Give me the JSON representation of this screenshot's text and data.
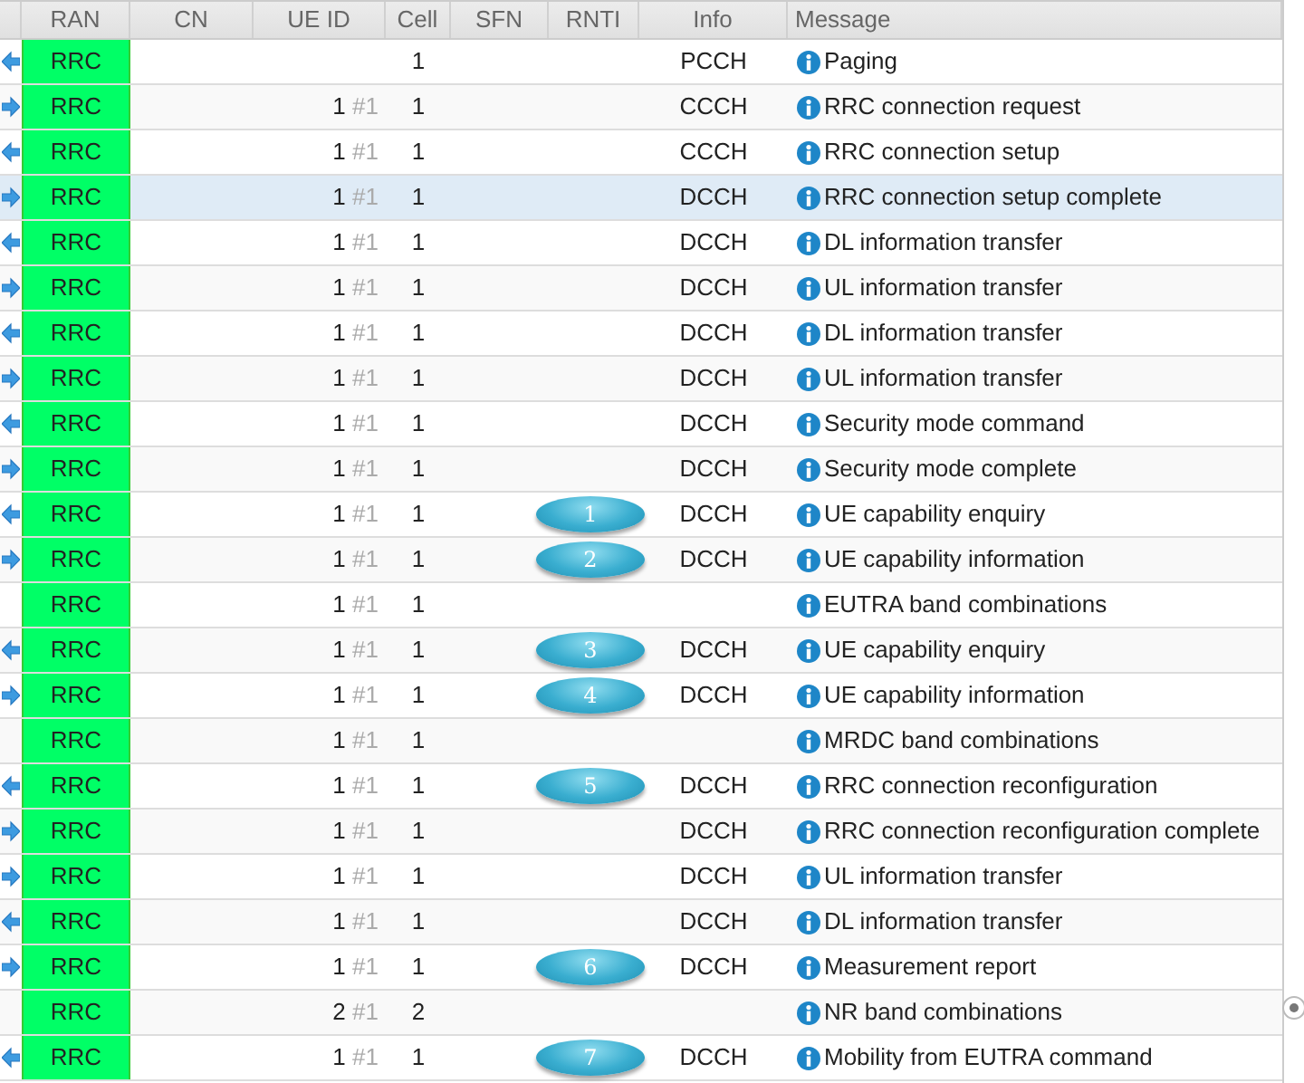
{
  "columns": [
    "RAN",
    "CN",
    "UE ID",
    "Cell",
    "SFN",
    "RNTI",
    "Info",
    "Message"
  ],
  "rows": [
    {
      "kind": "downlink",
      "ran": "RRC",
      "cell": "1",
      "info": "PCCH",
      "message": "Paging",
      "selected": false
    },
    {
      "kind": "uplink",
      "ran": "RRC",
      "ue_id": "1",
      "ue_index": "#1",
      "cell": "1",
      "info": "CCCH",
      "message": "RRC connection request",
      "selected": false
    },
    {
      "kind": "downlink",
      "ran": "RRC",
      "ue_id": "1",
      "ue_index": "#1",
      "cell": "1",
      "info": "CCCH",
      "message": "RRC connection setup",
      "selected": false
    },
    {
      "kind": "uplink",
      "ran": "RRC",
      "ue_id": "1",
      "ue_index": "#1",
      "cell": "1",
      "info": "DCCH",
      "message": "RRC connection setup complete",
      "selected": true
    },
    {
      "kind": "downlink",
      "ran": "RRC",
      "ue_id": "1",
      "ue_index": "#1",
      "cell": "1",
      "info": "DCCH",
      "message": "DL information transfer",
      "selected": false
    },
    {
      "kind": "uplink",
      "ran": "RRC",
      "ue_id": "1",
      "ue_index": "#1",
      "cell": "1",
      "info": "DCCH",
      "message": "UL information transfer",
      "selected": false
    },
    {
      "kind": "downlink",
      "ran": "RRC",
      "ue_id": "1",
      "ue_index": "#1",
      "cell": "1",
      "info": "DCCH",
      "message": "DL information transfer",
      "selected": false
    },
    {
      "kind": "uplink",
      "ran": "RRC",
      "ue_id": "1",
      "ue_index": "#1",
      "cell": "1",
      "info": "DCCH",
      "message": "UL information transfer",
      "selected": false
    },
    {
      "kind": "downlink",
      "ran": "RRC",
      "ue_id": "1",
      "ue_index": "#1",
      "cell": "1",
      "info": "DCCH",
      "message": "Security mode command",
      "selected": false
    },
    {
      "kind": "uplink",
      "ran": "RRC",
      "ue_id": "1",
      "ue_index": "#1",
      "cell": "1",
      "info": "DCCH",
      "message": "Security mode complete",
      "selected": false
    },
    {
      "kind": "downlink",
      "ran": "RRC",
      "ue_id": "1",
      "ue_index": "#1",
      "cell": "1",
      "marker": "1",
      "info": "DCCH",
      "message": "UE capability enquiry",
      "selected": false
    },
    {
      "kind": "uplink",
      "ran": "RRC",
      "ue_id": "1",
      "ue_index": "#1",
      "cell": "1",
      "marker": "2",
      "info": "DCCH",
      "message": "UE capability information",
      "selected": false
    },
    {
      "kind": "note",
      "ran": "RRC",
      "ue_id": "1",
      "ue_index": "#1",
      "cell": "1",
      "message": "EUTRA band combinations",
      "selected": false
    },
    {
      "kind": "downlink",
      "ran": "RRC",
      "ue_id": "1",
      "ue_index": "#1",
      "cell": "1",
      "marker": "3",
      "info": "DCCH",
      "message": "UE capability enquiry",
      "selected": false
    },
    {
      "kind": "uplink",
      "ran": "RRC",
      "ue_id": "1",
      "ue_index": "#1",
      "cell": "1",
      "marker": "4",
      "info": "DCCH",
      "message": "UE capability information",
      "selected": false
    },
    {
      "kind": "note",
      "ran": "RRC",
      "ue_id": "1",
      "ue_index": "#1",
      "cell": "1",
      "message": "MRDC band combinations",
      "selected": false
    },
    {
      "kind": "downlink",
      "ran": "RRC",
      "ue_id": "1",
      "ue_index": "#1",
      "cell": "1",
      "marker": "5",
      "info": "DCCH",
      "message": "RRC connection reconfiguration",
      "selected": false
    },
    {
      "kind": "uplink",
      "ran": "RRC",
      "ue_id": "1",
      "ue_index": "#1",
      "cell": "1",
      "info": "DCCH",
      "message": "RRC connection reconfiguration complete",
      "selected": false
    },
    {
      "kind": "uplink",
      "ran": "RRC",
      "ue_id": "1",
      "ue_index": "#1",
      "cell": "1",
      "info": "DCCH",
      "message": "UL information transfer",
      "selected": false
    },
    {
      "kind": "downlink",
      "ran": "RRC",
      "ue_id": "1",
      "ue_index": "#1",
      "cell": "1",
      "info": "DCCH",
      "message": "DL information transfer",
      "selected": false
    },
    {
      "kind": "uplink",
      "ran": "RRC",
      "ue_id": "1",
      "ue_index": "#1",
      "cell": "1",
      "marker": "6",
      "info": "DCCH",
      "message": "Measurement report",
      "selected": false
    },
    {
      "kind": "note",
      "ran": "RRC",
      "ue_id": "2",
      "ue_index": "#1",
      "cell": "2",
      "message": "NR band combinations",
      "selected": false
    },
    {
      "kind": "downlink",
      "ran": "RRC",
      "ue_id": "1",
      "ue_index": "#1",
      "cell": "1",
      "marker": "7",
      "info": "DCCH",
      "message": "Mobility from EUTRA command",
      "selected": false
    }
  ]
}
